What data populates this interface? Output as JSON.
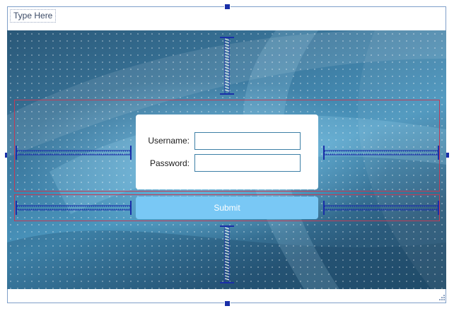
{
  "menu_bar": {
    "placeholder_text": "Type Here"
  },
  "login_form": {
    "username_label": "Username:",
    "password_label": "Password:",
    "username_value": "",
    "password_value": "",
    "submit_label": "Submit"
  },
  "colors": {
    "selection_handle": "#1a2fa8",
    "layout_border": "#c23a55",
    "spacer": "#1a2fa8",
    "submit_button": "#79c8f5",
    "field_border": "#3d7fa6"
  }
}
